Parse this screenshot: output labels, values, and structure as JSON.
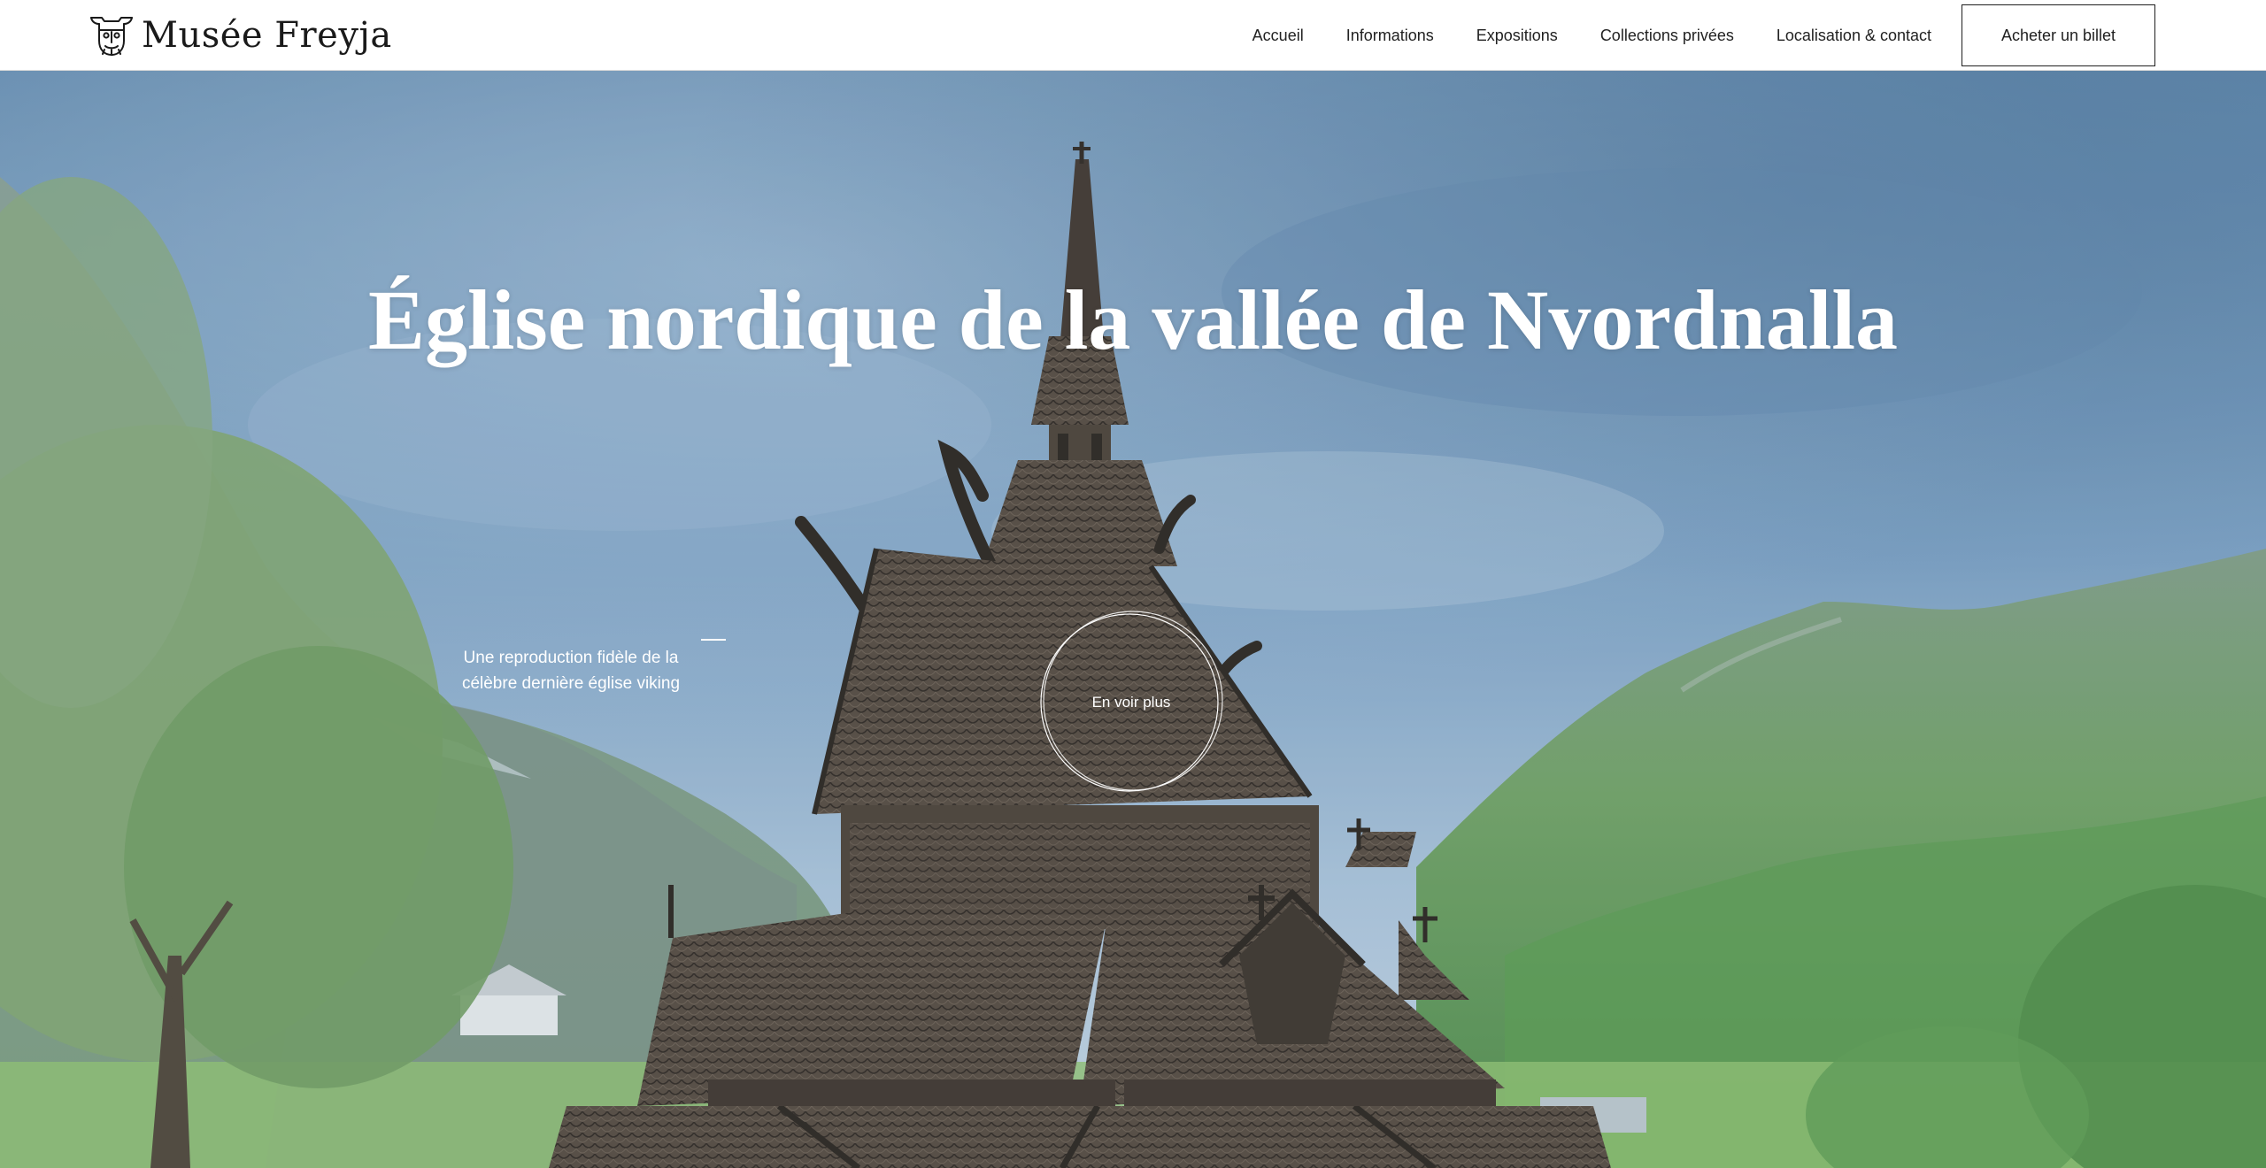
{
  "brand": {
    "name": "Musée Freyja",
    "logo_icon": "viking-mask-icon"
  },
  "nav": {
    "items": [
      {
        "label": "Accueil"
      },
      {
        "label": "Informations"
      },
      {
        "label": "Expositions"
      },
      {
        "label": "Collections privées"
      },
      {
        "label": "Localisation & contact"
      }
    ],
    "cta_label": "Acheter un billet"
  },
  "hero": {
    "title": "Église nordique de la vallée de Nvordnalla",
    "subtitle": "Une reproduction fidèle de la célèbre dernière église viking",
    "see_more_label": "En voir plus",
    "background": "stave-church-mountain-valley-photo"
  },
  "colors": {
    "header_bg": "#ffffff",
    "text_dark": "#1f1f1f",
    "hero_text": "#ffffff",
    "sky": "#6f94b6",
    "forest": "#5e9b5a",
    "wood": "#4a3f35"
  }
}
